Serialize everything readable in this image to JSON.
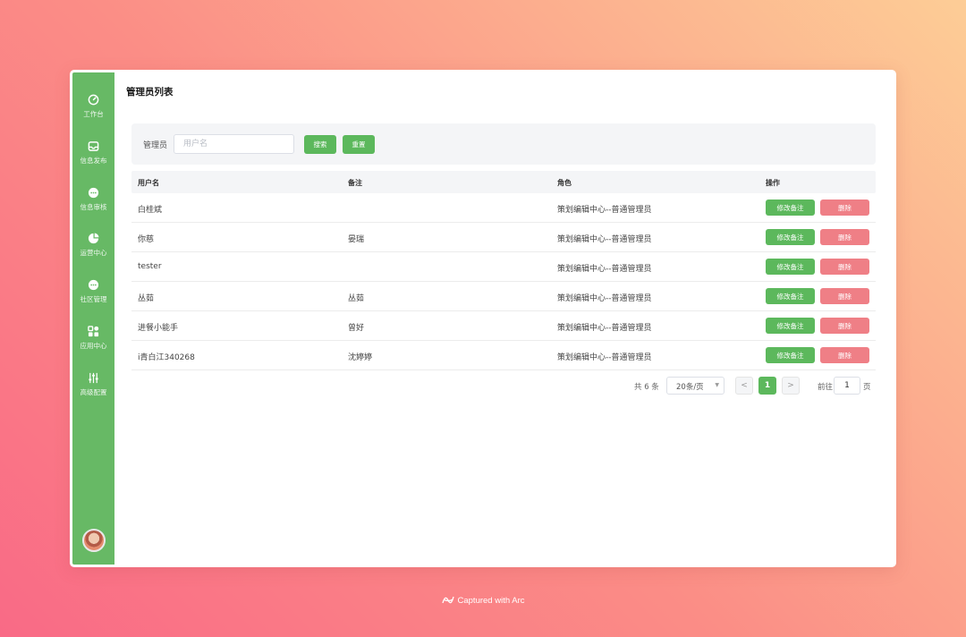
{
  "sidebar": {
    "items": [
      {
        "label": "工作台",
        "icon": "dashboard-icon"
      },
      {
        "label": "信息发布",
        "icon": "inbox-icon"
      },
      {
        "label": "信息审核",
        "icon": "chat-icon"
      },
      {
        "label": "运营中心",
        "icon": "pie-chart-icon"
      },
      {
        "label": "社区管理",
        "icon": "message-icon"
      },
      {
        "label": "应用中心",
        "icon": "apps-icon"
      },
      {
        "label": "高级配置",
        "icon": "sliders-icon"
      }
    ]
  },
  "page": {
    "title": "管理员列表"
  },
  "filter": {
    "label": "管理员",
    "placeholder": "用户名",
    "search_label": "搜索",
    "reset_label": "重置"
  },
  "table": {
    "headers": [
      "用户名",
      "备注",
      "角色",
      "操作"
    ],
    "rows": [
      {
        "username": "白桂斌",
        "note": "",
        "role": "策划编辑中心--普通管理员"
      },
      {
        "username": "你慈",
        "note": "晏瑞",
        "role": "策划编辑中心--普通管理员"
      },
      {
        "username": "tester",
        "note": "",
        "role": "策划编辑中心--普通管理员"
      },
      {
        "username": "丛茹",
        "note": "丛茹",
        "role": "策划编辑中心--普通管理员"
      },
      {
        "username": "进餐小能手",
        "note": "曾好",
        "role": "策划编辑中心--普通管理员"
      },
      {
        "username": "i青白江340268",
        "note": "沈婷婷",
        "role": "策划编辑中心--普通管理员"
      }
    ],
    "edit_label": "修改备注",
    "delete_label": "删除"
  },
  "pagination": {
    "total": "共 6 条",
    "page_size": "20条/页",
    "prev": "<",
    "current": "1",
    "next": ">",
    "goto_label": "前往",
    "goto_value": "1",
    "page_unit": "页"
  },
  "footer": {
    "brand": "Captured with Arc"
  },
  "colors": {
    "accent": "#67b965",
    "button_green": "#5cb85c",
    "button_red": "#ef7f86"
  }
}
